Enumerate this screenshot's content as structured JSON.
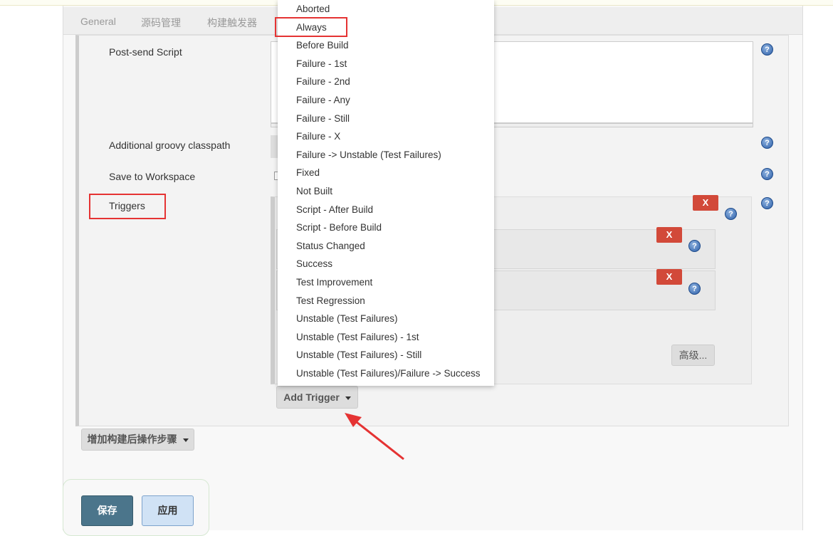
{
  "tabs": [
    "General",
    "源码管理",
    "构建触发器"
  ],
  "fields": {
    "post_send_script": "Post-send Script",
    "groovy_classpath": "Additional groovy classpath",
    "save_to_workspace": "Save to Workspace",
    "triggers": "Triggers"
  },
  "buttons": {
    "remove": "X",
    "advanced": "高级...",
    "add_trigger": "Add Trigger",
    "add_post_build": "增加构建后操作步骤",
    "save": "保存",
    "apply": "应用"
  },
  "help_icon": "?",
  "dropdown": {
    "highlighted": "Always",
    "items": [
      "Aborted",
      "Always",
      "Before Build",
      "Failure - 1st",
      "Failure - 2nd",
      "Failure - Any",
      "Failure - Still",
      "Failure - X",
      "Failure -> Unstable (Test Failures)",
      "Fixed",
      "Not Built",
      "Script - After Build",
      "Script - Before Build",
      "Status Changed",
      "Success",
      "Test Improvement",
      "Test Regression",
      "Unstable (Test Failures)",
      "Unstable (Test Failures) - 1st",
      "Unstable (Test Failures) - Still",
      "Unstable (Test Failures)/Failure -> Success"
    ]
  },
  "colors": {
    "annotation": "#e53333",
    "save": "#4b758b",
    "remove": "#d24939"
  }
}
